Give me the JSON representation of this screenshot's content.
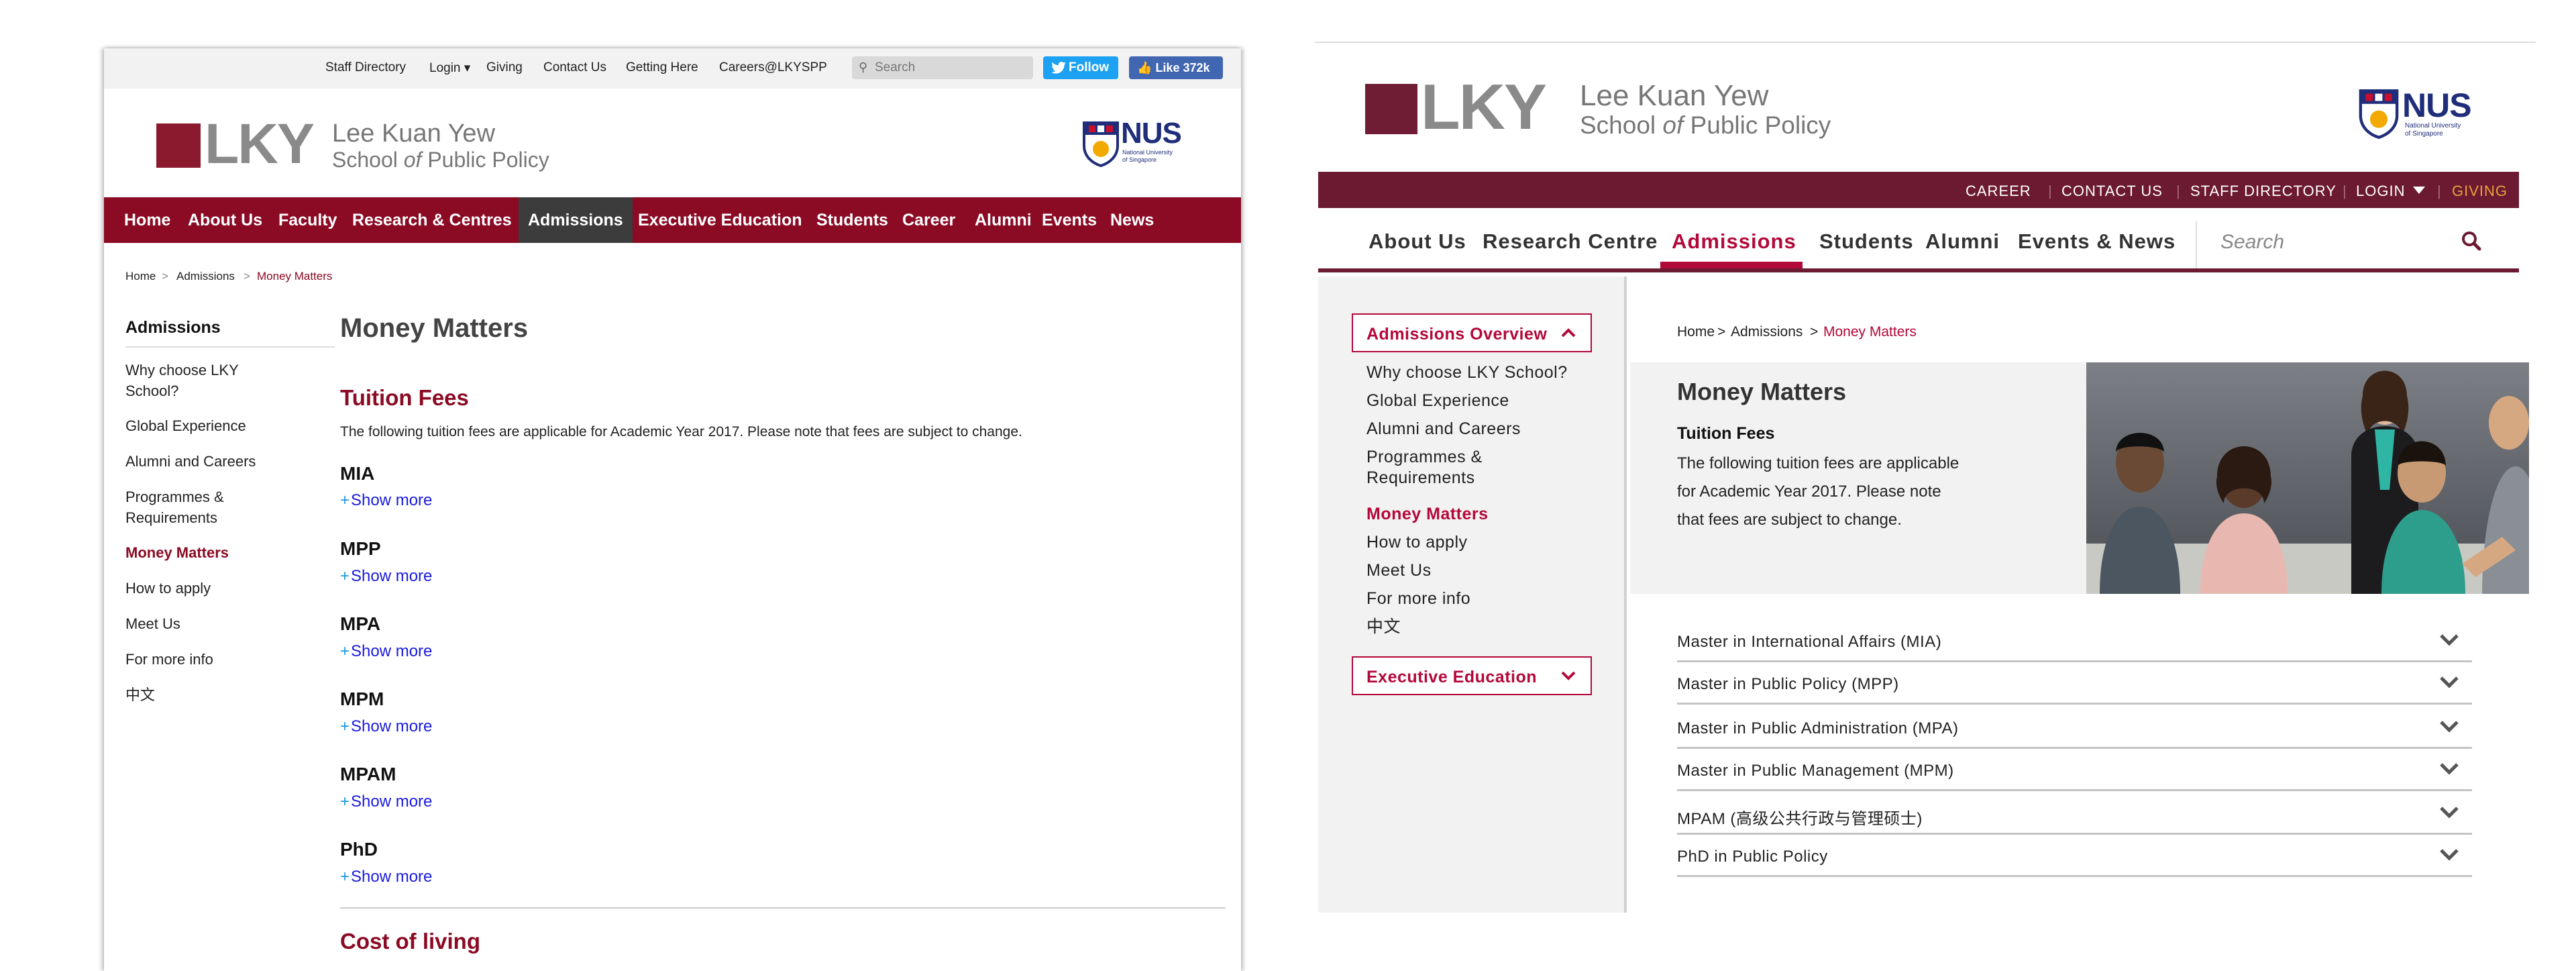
{
  "old_site": {
    "util_links": [
      "Staff Directory",
      "Login ▾",
      "Giving",
      "Contact Us",
      "Getting Here",
      "Careers@LKYSPP"
    ],
    "search_placeholder": "Search",
    "twitter_follow": "Follow",
    "facebook_like": "Like 372k",
    "logo": {
      "mark": "LKY",
      "name_line1": "Lee Kuan Yew",
      "name_line2_a": "School ",
      "name_line2_of": "of",
      "name_line2_b": " Public Policy"
    },
    "nus": {
      "short": "NUS",
      "full_line1": "National University",
      "full_line2": "of Singapore"
    },
    "nav": [
      "Home",
      "About Us",
      "Faculty",
      "Research & Centres",
      "Admissions",
      "Executive Education",
      "Students",
      "Career",
      "Alumni",
      "Events",
      "News"
    ],
    "breadcrumb": {
      "home": "Home",
      "sep": ">",
      "admissions": "Admissions",
      "current": "Money Matters"
    },
    "sidebar": {
      "title": "Admissions",
      "items": [
        "Why choose LKY School?",
        "Global Experience",
        "Alumni and Careers",
        "Programmes & Requirements",
        "Money Matters",
        "How to apply",
        "Meet Us",
        "For more info",
        "中文"
      ]
    },
    "content": {
      "title": "Money Matters",
      "section1": "Tuition Fees",
      "intro": "The following tuition fees are applicable for Academic Year 2017. Please note that fees are subject to change.",
      "programmes": [
        "MIA",
        "MPP",
        "MPA",
        "MPM",
        "MPAM",
        "PhD"
      ],
      "show_more": "Show more",
      "section2": "Cost of living"
    }
  },
  "new_site": {
    "logo": {
      "mark": "LKY",
      "name_line1": "Lee Kuan Yew",
      "name_line2_a": "School ",
      "name_line2_of": "of",
      "name_line2_b": " Public Policy"
    },
    "nus": {
      "short": "NUS",
      "full_line1": "National University",
      "full_line2": "of Singapore"
    },
    "topbar": [
      "CAREER",
      "CONTACT US",
      "STAFF DIRECTORY",
      "LOGIN",
      "GIVING"
    ],
    "nav": [
      "About Us",
      "Research Centre",
      "Admissions",
      "Students",
      "Alumni",
      "Events & News"
    ],
    "search_placeholder": "Search",
    "sidebar": {
      "overview_button": "Admissions Overview",
      "items": [
        "Why choose LKY School?",
        "Global Experience",
        "Alumni and Careers",
        "Programmes & Requirements",
        "Money Matters",
        "How to apply",
        "Meet Us",
        "For more info",
        "中文"
      ],
      "exec_button": "Executive Education"
    },
    "breadcrumb": {
      "home": "Home",
      "sep": ">",
      "admissions": "Admissions",
      "current": "Money Matters"
    },
    "content": {
      "title": "Money Matters",
      "subhead": "Tuition Fees",
      "intro": "The following tuition fees are applicable for Academic Year 2017. Please note that fees are subject to change.",
      "accordion": [
        "Master in International Affairs (MIA)",
        "Master in Public Policy (MPP)",
        "Master in Public Administration (MPA)",
        "Master in Public Management (MPM)",
        "MPAM (高级公共行政与管理硕士)",
        "PhD in Public Policy"
      ]
    }
  },
  "colors": {
    "old_brand": "#8b0a24",
    "new_brand": "#6b1a32",
    "new_accent": "#b3083a",
    "giving": "#e8a13a",
    "twitter": "#1da1f2",
    "facebook": "#4267b2"
  }
}
